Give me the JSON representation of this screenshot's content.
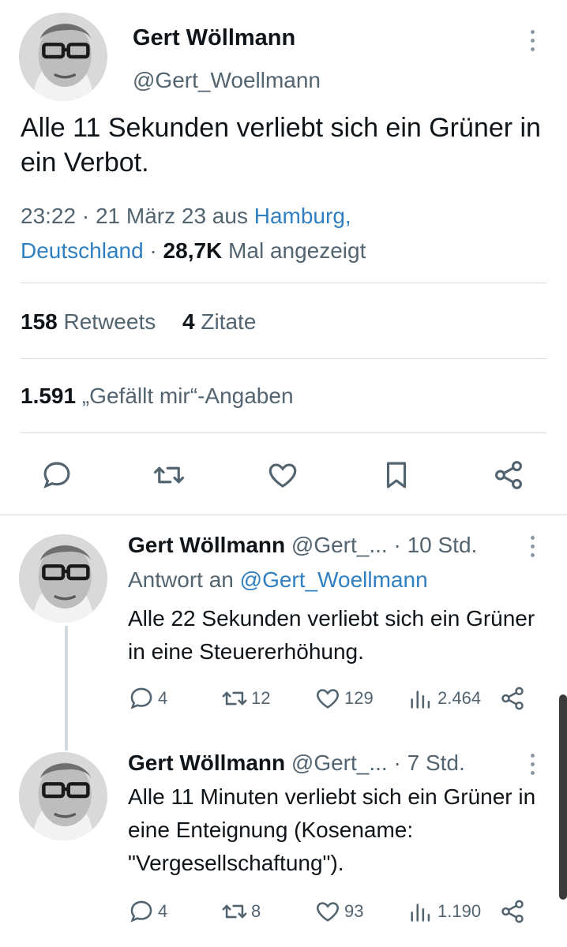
{
  "main_tweet": {
    "author_name": "Gert Wöllmann",
    "author_handle": "@Gert_Woellmann",
    "text": "Alle 11 Sekunden verliebt sich ein Grüner in ein Verbot.",
    "time": "23:22 · 21 März 23 aus ",
    "location_line1": "Hamburg,",
    "location_line2": "Deutschland",
    "views_sep": " · ",
    "views_count": "28,7K",
    "views_label": " Mal angezeigt",
    "retweets_count": "158",
    "retweets_label": "Retweets",
    "quotes_count": "4",
    "quotes_label": "Zitate",
    "likes_count": "1.591",
    "likes_label": "„Gefällt mir“-Angaben",
    "actions": [
      "comment-icon",
      "retweet-icon",
      "heart-icon",
      "bookmark-icon",
      "share-icon"
    ]
  },
  "replies": [
    {
      "name": "Gert Wöllmann",
      "handle": "@Gert_...",
      "time": " · 10 Std.",
      "reply_to_label": "Antwort an ",
      "reply_to_handle": "@Gert_Woellmann",
      "text": "Alle 22 Sekunden verliebt sich ein Grüner in eine Steuererhöhung.",
      "replies": "4",
      "retweets": "12",
      "likes": "129",
      "views": "2.464"
    },
    {
      "name": "Gert Wöllmann",
      "handle": "@Gert_...",
      "time": " · 7 Std.",
      "text": "Alle 11 Minuten verliebt sich ein Grüner in eine Enteignung (Kosename: \"Vergesellschaftung\").",
      "replies": "4",
      "retweets": "8",
      "likes": "93",
      "views": "1.190"
    }
  ],
  "colors": {
    "text": "#0f1419",
    "secondary": "#536471",
    "link": "#2f7fc1",
    "divider": "#d6dbdf"
  }
}
